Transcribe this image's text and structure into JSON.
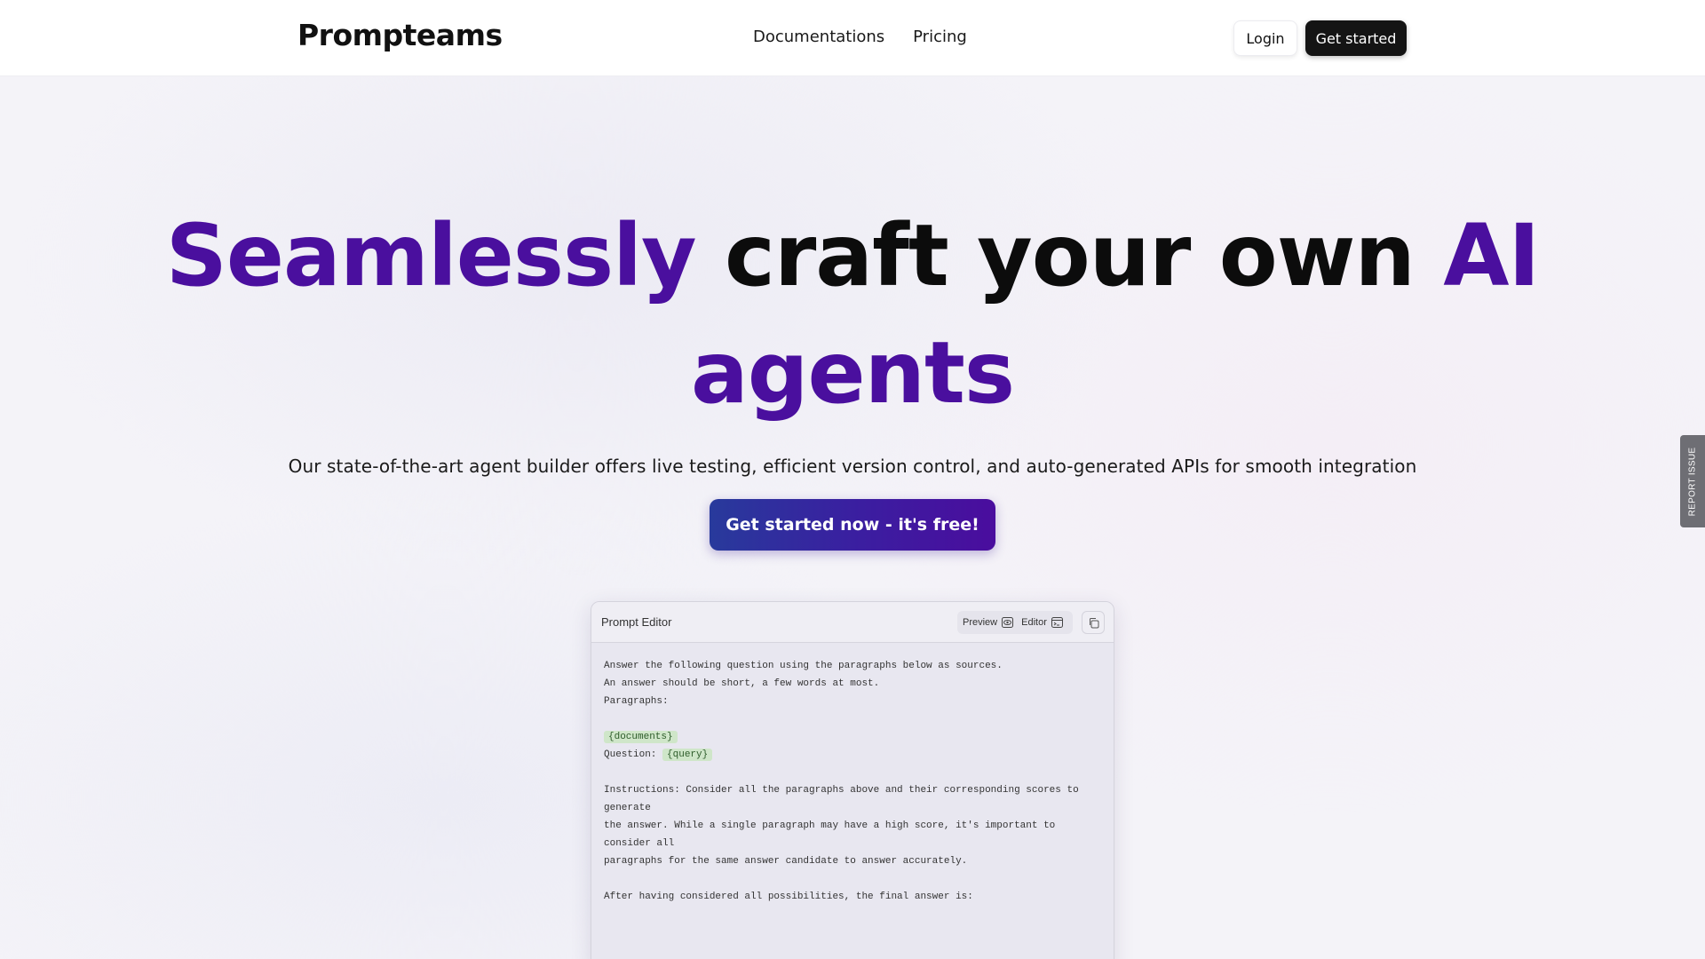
{
  "nav": {
    "brand": "Prompteams",
    "links": [
      "Documentations",
      "Pricing"
    ],
    "login_label": "Login",
    "get_started_label": "Get started"
  },
  "hero": {
    "title_part1": "Seamlessly",
    "title_part2": "craft your own",
    "title_part3": "AI agents",
    "subtitle": "Our state-of-the-art agent builder offers live testing, efficient version control, and auto-generated APIs for smooth integration",
    "cta_label": "Get started now - it's free!"
  },
  "editor": {
    "title": "Prompt Editor",
    "preview_label": "Preview",
    "editor_label": "Editor",
    "lines": [
      "Answer the following question using the paragraphs below as sources.",
      "An answer should be short, a few words at most.",
      "Paragraphs:",
      "",
      "{documents}",
      "Question: {query}",
      "",
      "Instructions: Consider all the paragraphs above and their corresponding scores to",
      "generate",
      "the answer. While a single paragraph may have a high score, it's important to",
      "consider all",
      "paragraphs for the same answer candidate to answer accurately.",
      "",
      "After having considered all possibilities, the final answer is:"
    ],
    "var_documents": "{documents}",
    "question_prefix": "Question: ",
    "var_query": "{query}"
  },
  "report_issue_label": "REPORT ISSUE",
  "colors": {
    "accent_purple": "#4a0f9e",
    "cta_gradient_start": "#283a9c",
    "cta_gradient_end": "#4a0d9e",
    "dark_button": "#141414",
    "variable_highlight": "#cfe6c9"
  },
  "icons": [
    "eye-icon",
    "code-editor-icon",
    "copy-icon"
  ]
}
